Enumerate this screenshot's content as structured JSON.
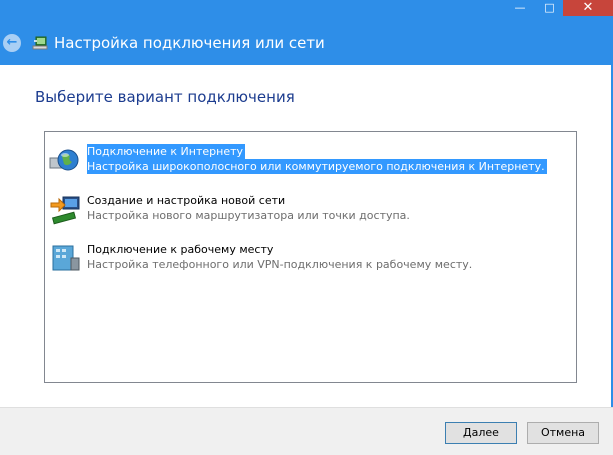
{
  "window": {
    "title": "Настройка подключения или сети",
    "minimize_glyph": "—",
    "maximize_glyph": "□",
    "close_glyph": "✕",
    "back_glyph": "←",
    "accent": "#2e8ee8"
  },
  "main": {
    "heading": "Выберите вариант подключения",
    "options": [
      {
        "title": "Подключение к Интернету",
        "description": "Настройка широкополосного или коммутируемого подключения к Интернету.",
        "icon": "globe-icon",
        "selected": true
      },
      {
        "title": "Создание и настройка новой сети",
        "description": "Настройка нового маршрутизатора или точки доступа.",
        "icon": "network-setup-icon",
        "selected": false
      },
      {
        "title": "Подключение к рабочему месту",
        "description": "Настройка телефонного или VPN-подключения к рабочему месту.",
        "icon": "workplace-icon",
        "selected": false
      }
    ]
  },
  "footer": {
    "next_label": "Далее",
    "cancel_label": "Отмена"
  }
}
